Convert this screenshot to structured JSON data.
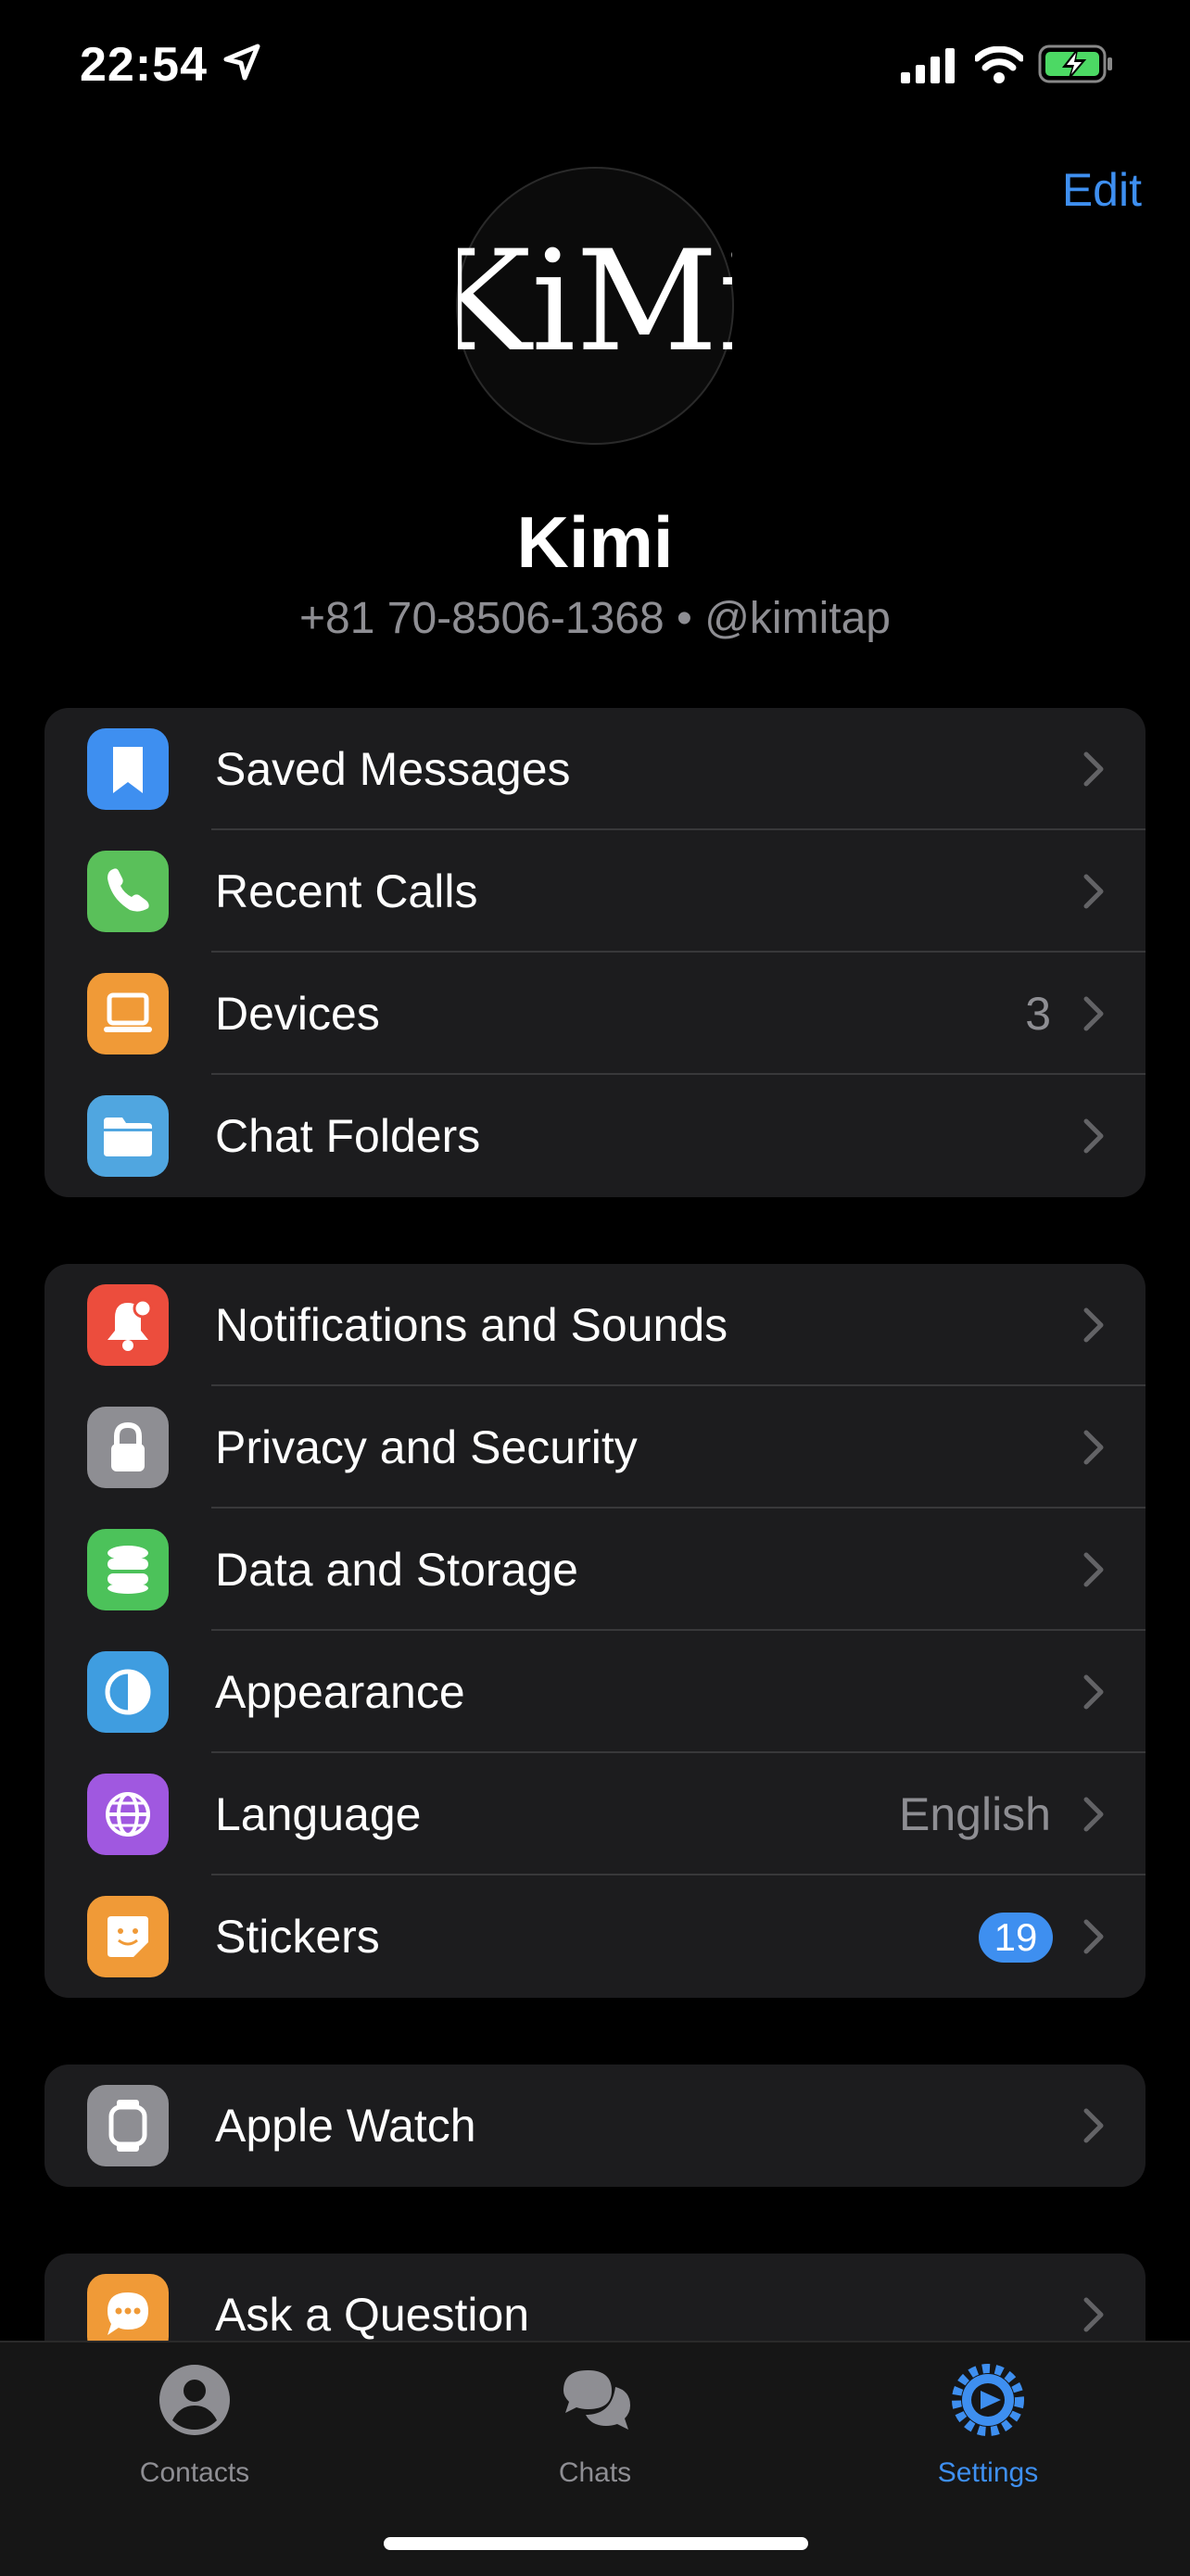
{
  "status": {
    "time": "22:54"
  },
  "header": {
    "edit": "Edit"
  },
  "profile": {
    "avatar_text": "KiMi",
    "name": "Kimi",
    "phone": "+81 70-8506-1368",
    "username": "@kimitap",
    "separator": "•"
  },
  "groups": [
    {
      "items": [
        {
          "label": "Saved Messages",
          "icon": "bookmark-icon",
          "color": "#3e8ff0"
        },
        {
          "label": "Recent Calls",
          "icon": "phone-icon",
          "color": "#5ac05a"
        },
        {
          "label": "Devices",
          "value": "3",
          "icon": "laptop-icon",
          "color": "#f09a37"
        },
        {
          "label": "Chat Folders",
          "icon": "folder-icon",
          "color": "#50a6e0"
        }
      ]
    },
    {
      "items": [
        {
          "label": "Notifications and Sounds",
          "icon": "bell-icon",
          "color": "#ec4d3d"
        },
        {
          "label": "Privacy and Security",
          "icon": "lock-icon",
          "color": "#8e8e93"
        },
        {
          "label": "Data and Storage",
          "icon": "database-icon",
          "color": "#4cc25a"
        },
        {
          "label": "Appearance",
          "icon": "half-circle-icon",
          "color": "#3f9de0"
        },
        {
          "label": "Language",
          "value": "English",
          "icon": "globe-icon",
          "color": "#a058e0"
        },
        {
          "label": "Stickers",
          "badge": "19",
          "icon": "sticker-icon",
          "color": "#f09a37"
        }
      ]
    },
    {
      "items": [
        {
          "label": "Apple Watch",
          "icon": "watch-icon",
          "color": "#8e8e93"
        }
      ]
    },
    {
      "items": [
        {
          "label": "Ask a Question",
          "icon": "chat-bubble-icon",
          "color": "#f09a37"
        }
      ]
    }
  ],
  "tabs": [
    {
      "label": "Contacts",
      "icon": "person-icon"
    },
    {
      "label": "Chats",
      "icon": "chats-icon"
    },
    {
      "label": "Settings",
      "icon": "gear-icon",
      "active": true
    }
  ],
  "colors": {
    "accent": "#3e8ff0",
    "background": "#000000",
    "group_bg": "#1c1c1e"
  }
}
